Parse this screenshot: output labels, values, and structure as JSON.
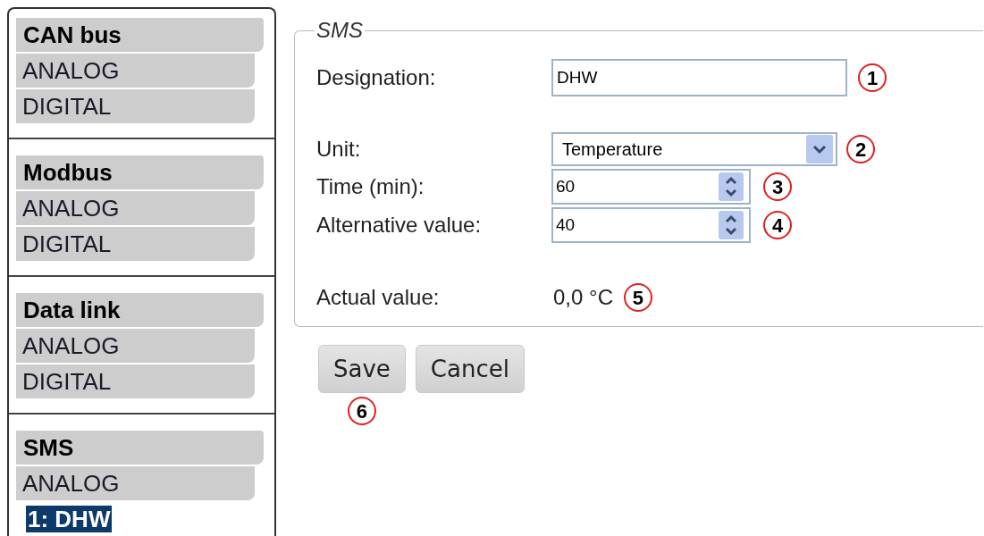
{
  "sidebar": {
    "groups": [
      {
        "title": "CAN bus",
        "items": [
          {
            "label": "ANALOG",
            "selected": false
          },
          {
            "label": "DIGITAL",
            "selected": false
          }
        ]
      },
      {
        "title": "Modbus",
        "items": [
          {
            "label": "ANALOG",
            "selected": false
          },
          {
            "label": "DIGITAL",
            "selected": false
          }
        ]
      },
      {
        "title": "Data link",
        "items": [
          {
            "label": "ANALOG",
            "selected": false
          },
          {
            "label": "DIGITAL",
            "selected": false
          }
        ]
      },
      {
        "title": "SMS",
        "items": [
          {
            "label": "ANALOG",
            "selected": false
          },
          {
            "label": "1: DHW",
            "selected": true
          }
        ]
      }
    ]
  },
  "form": {
    "legend": "SMS",
    "fields": [
      {
        "kind": "text",
        "label": "Designation:",
        "value": "DHW",
        "callout": "1"
      },
      {
        "kind": "select",
        "label": "Unit:",
        "value": "Temperature",
        "callout": "2"
      },
      {
        "kind": "spin",
        "label": "Time (min):",
        "value": "60",
        "callout": "3"
      },
      {
        "kind": "spin",
        "label": "Alternative value:",
        "value": "40",
        "callout": "4"
      },
      {
        "kind": "readout",
        "label": "Actual value:",
        "value": "0,0 °C",
        "callout": "5"
      }
    ]
  },
  "buttons": [
    {
      "label": "Save",
      "callout": "6"
    },
    {
      "label": "Cancel"
    }
  ]
}
